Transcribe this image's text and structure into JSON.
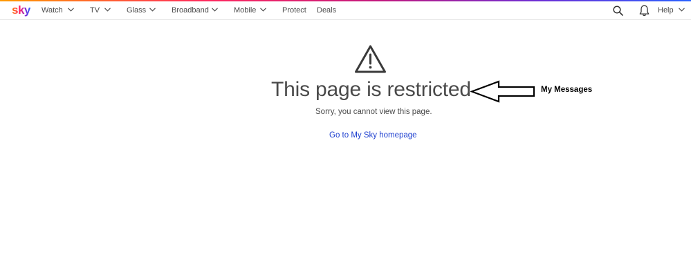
{
  "header": {
    "logo": "sky",
    "nav": [
      {
        "label": "Watch",
        "has_dropdown": true
      },
      {
        "label": "TV",
        "has_dropdown": true
      },
      {
        "label": "Glass",
        "has_dropdown": true
      },
      {
        "label": "Broadband",
        "has_dropdown": true
      },
      {
        "label": "Mobile",
        "has_dropdown": true
      },
      {
        "label": "Protect",
        "has_dropdown": false
      },
      {
        "label": "Deals",
        "has_dropdown": false
      }
    ],
    "help_label": "Help",
    "icons": [
      "search-icon",
      "bell-icon"
    ]
  },
  "main": {
    "icon": "warning-triangle-icon",
    "title": "This page is restricted",
    "subtitle": "Sorry, you cannot view this page.",
    "link_label": "Go to My Sky homepage",
    "link_color": "#1d3fcf"
  },
  "annotation": {
    "label": "My Messages",
    "icon": "left-arrow-icon"
  }
}
